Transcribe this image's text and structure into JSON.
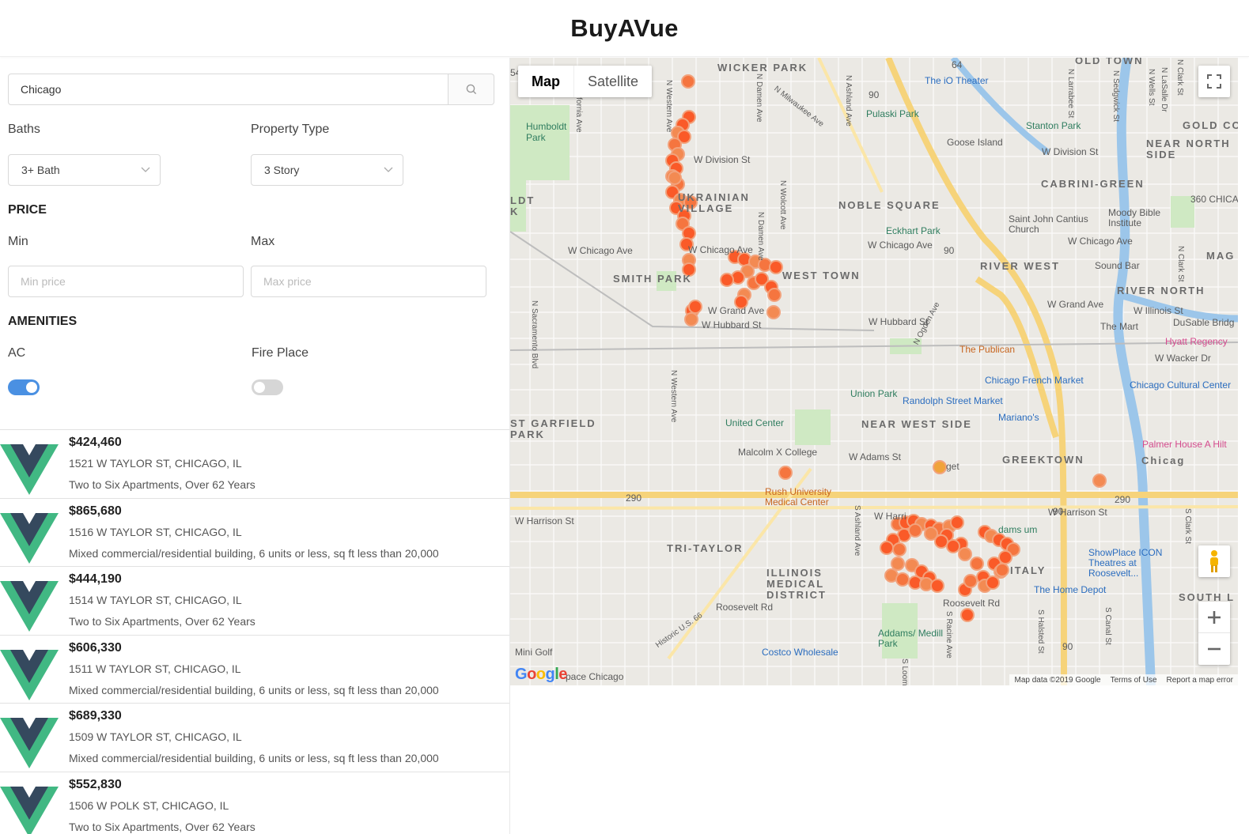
{
  "app": {
    "title": "BuyAVue"
  },
  "search": {
    "value": "Chicago"
  },
  "filters": {
    "baths_label": "Baths",
    "baths_value": "3+ Bath",
    "property_type_label": "Property Type",
    "property_type_value": "3 Story",
    "price_heading": "PRICE",
    "min_label": "Min",
    "min_placeholder": "Min price",
    "max_label": "Max",
    "max_placeholder": "Max price",
    "amenities_heading": "AMENITIES",
    "ac_label": "AC",
    "ac_on": true,
    "fireplace_label": "Fire Place",
    "fireplace_on": false
  },
  "listings": [
    {
      "price": "$424,460",
      "address": "1521 W TAYLOR ST, CHICAGO, IL",
      "description": "Two to Six Apartments, Over 62 Years"
    },
    {
      "price": "$865,680",
      "address": "1516 W TAYLOR ST, CHICAGO, IL",
      "description": "Mixed commercial/residential building, 6 units or less, sq ft less than 20,000"
    },
    {
      "price": "$444,190",
      "address": "1514 W TAYLOR ST, CHICAGO, IL",
      "description": "Two to Six Apartments, Over 62 Years"
    },
    {
      "price": "$606,330",
      "address": "1511 W TAYLOR ST, CHICAGO, IL",
      "description": "Mixed commercial/residential building, 6 units or less, sq ft less than 20,000"
    },
    {
      "price": "$689,330",
      "address": "1509 W TAYLOR ST, CHICAGO, IL",
      "description": "Mixed commercial/residential building, 6 units or less, sq ft less than 20,000"
    },
    {
      "price": "$552,830",
      "address": "1506 W POLK ST, CHICAGO, IL",
      "description": "Two to Six Apartments, Over 62 Years"
    }
  ],
  "map": {
    "map_button": "Map",
    "satellite_button": "Satellite",
    "google": "Google",
    "attribution": {
      "data": "Map data ©2019 Google",
      "terms": "Terms of Use",
      "report": "Report a map error"
    },
    "labels": {
      "wicker_park": "WICKER PARK",
      "old_town": "OLD TOWN",
      "humboldt_park": "Humboldt Park",
      "pulaski_park": "Pulaski Park",
      "io_theater": "The iO Theater",
      "stanton_park": "Stanton Park",
      "goose_island": "Goose Island",
      "gold_coast": "GOLD CO",
      "near_north": "NEAR NORTH SIDE",
      "w_division_1": "W Division St",
      "w_division_2": "W Division St",
      "ukr_village": "UKRAINIAN VILLAGE",
      "west_town": "WEST TOWN",
      "noble_square": "NOBLE SQUARE",
      "cabrini": "CABRINI-GREEN",
      "chicago_360": "360 CHICA",
      "eckhart_park": "Eckhart Park",
      "saint_john": "Saint John Cantius Church",
      "moody": "Moody Bible Institute",
      "w_chicago_1": "W Chicago Ave",
      "w_chicago_2": "W Chicago Ave",
      "w_chicago_3": "W Chicago Ave",
      "w_chicago_4": "W Chicago Ave",
      "smith_park": "SMITH PARK",
      "river_west": "RIVER WEST",
      "sound_bar": "Sound Bar",
      "mag": "MAG",
      "river_north": "RIVER NORTH",
      "w_grand_1": "W Grand Ave",
      "w_grand_2": "W Grand Ave",
      "w_illinois": "W Illinois St",
      "the_mart": "The Mart",
      "dusable": "DuSable Bridg",
      "w_hubbard_1": "W Hubbard St",
      "w_hubbard_2": "W Hubbard St",
      "hyatt": "Hyatt Regency",
      "the_publican": "The Publican",
      "w_wacker": "W Wacker Dr",
      "chicago_french": "Chicago French Market",
      "cultural_center": "Chicago Cultural Center",
      "union_park": "Union Park",
      "randolph": "Randolph Street Market",
      "marianos": "Mariano's",
      "east_garfield": "ST GARFIELD PARK",
      "united_center": "United Center",
      "near_west": "NEAR WEST SIDE",
      "palmer": "Palmer House A Hilt",
      "malcolm": "Malcolm X College",
      "w_adams": "W Adams St",
      "target": "get",
      "greektown": "GREEKTOWN",
      "chicago_big": "Chicag",
      "rush": "Rush University Medical Center",
      "w_harrison_1": "W Harrison St",
      "w_harrison_2": "W Harrison St",
      "w_harrison_3": "W Harri",
      "tri_taylor": "TRI-TAYLOR",
      "illinois_medical": "ILLINOIS MEDICAL DISTRICT",
      "little_italy": "ITALY",
      "showplace": "ShowPlace ICON Theatres at Roosevelt...",
      "home_depot": "The Home Depot",
      "south_l": "SOUTH L",
      "roosevelt_1": "Roosevelt Rd",
      "roosevelt_2": "Roosevelt Rd",
      "addams": "Addams/ Medill Park",
      "costco": "Costco Wholesale",
      "mini_golf": "Mini Golf",
      "space_chicago": "pace Chicago",
      "historic_66": "Historic U.S. 66",
      "adams_museum": "dams um",
      "ashland": "S Ashland Ave",
      "ashland_n": "N Ashland Ave",
      "western_n": "N Western Ave",
      "western_n2": "N Western Ave",
      "damen": "N Damen Ave",
      "damen2": "N Damen Ave",
      "wolcott": "N Wolcott Ave",
      "milwaukee": "N Milwaukee Ave",
      "california": "ifornia Ave",
      "sacramento": "N Sacramento Blvd",
      "ogden": "N Ogden Ave",
      "racine": "S Racine Ave",
      "loomis": "S Loomis",
      "halsted": "S Halsted St",
      "canal": "S Canal St",
      "clark": "S Clark St",
      "larrabee": "N Larrabee St",
      "sedgwick": "N Sedgwick St",
      "wells": "N Wells St",
      "lasalle": "N LaSalle Dr",
      "clark_n": "N Clark St",
      "clark_n2": "N Clark St",
      "humboldt_ldt": "LDT K",
      "hwy_64": "64",
      "hwy_90_1": "90",
      "hwy_90_2": "90",
      "hwy_90_3": "90",
      "hwy_90_4": "90",
      "hwy_290_1": "290",
      "hwy_290_2": "290",
      "hwy_54": "54"
    }
  }
}
